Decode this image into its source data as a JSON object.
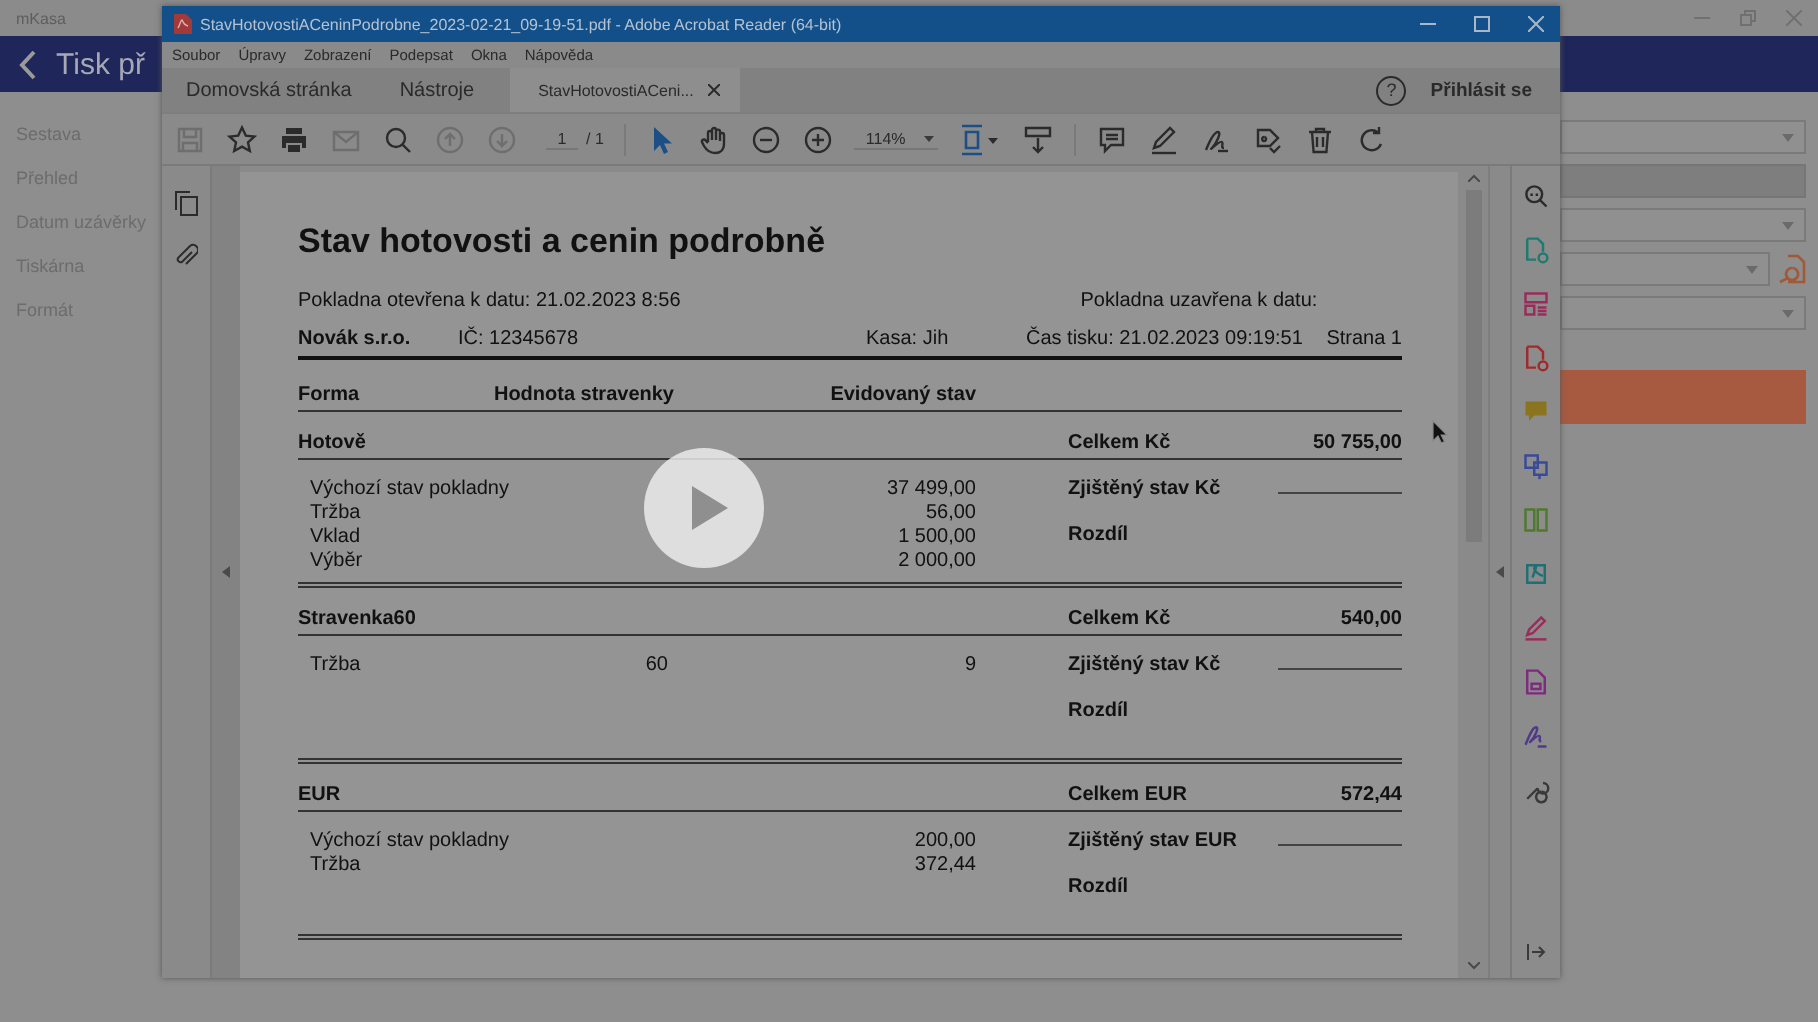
{
  "background_app": {
    "title": "mKasa",
    "header_title": "Tisk př",
    "nav_items": [
      "Sestava",
      "Přehled",
      "Datum uzávěrky",
      "Tiskárna",
      "Formát"
    ]
  },
  "acrobat": {
    "title": "StavHotovostiACeninPodrobne_2023-02-21_09-19-51.pdf - Adobe Acrobat Reader (64-bit)",
    "menu": [
      "Soubor",
      "Úpravy",
      "Zobrazení",
      "Podepsat",
      "Okna",
      "Nápověda"
    ],
    "tabs": [
      {
        "label": "Domovská stránka",
        "selected": false,
        "closable": false
      },
      {
        "label": "Nástroje",
        "selected": false,
        "closable": false
      },
      {
        "label": "StavHotovostiACeni...",
        "selected": true,
        "closable": true
      }
    ],
    "help": "?",
    "sign_in": "Přihlásit se",
    "page_number": "1",
    "page_count": "/ 1",
    "zoom": "114%"
  },
  "document": {
    "title": "Stav hotovosti a cenin podrobně",
    "opened": "Pokladna otevřena k datu: 21.02.2023 8:56",
    "closed": "Pokladna uzavřena k datu:",
    "company": "Novák s.r.o.",
    "ic": "IČ: 12345678",
    "register": "Kasa: Jih",
    "printed": "Čas tisku: 21.02.2023 09:19:51",
    "page": "Strana 1",
    "columns": [
      "Forma",
      "Hodnota stravenky",
      "Evidovaný stav"
    ],
    "sections": [
      {
        "name": "Hotově",
        "total_label": "Celkem Kč",
        "total": "50 755,00",
        "counted_label": "Zjištěný stav Kč",
        "difference_label": "Rozdíl",
        "rows": [
          {
            "label": "Výchozí stav pokladny",
            "amount": "37 499,00"
          },
          {
            "label": "Tržba",
            "amount": "56,00"
          },
          {
            "label": "Vklad",
            "amount": "1 500,00"
          },
          {
            "label": "Výběr",
            "amount": "2 000,00"
          }
        ]
      },
      {
        "name": "Stravenka60",
        "total_label": "Celkem Kč",
        "total": "540,00",
        "counted_label": "Zjištěný stav Kč",
        "difference_label": "Rozdíl",
        "rows": [
          {
            "label": "Tržba",
            "voucher_value": "60",
            "amount": "9"
          }
        ]
      },
      {
        "name": "EUR",
        "total_label": "Celkem EUR",
        "total": "572,44",
        "counted_label": "Zjištěný stav EUR",
        "difference_label": "Rozdíl",
        "rows": [
          {
            "label": "Výchozí stav pokladny",
            "amount": "200,00"
          },
          {
            "label": "Tržba",
            "amount": "372,44"
          }
        ]
      }
    ]
  }
}
